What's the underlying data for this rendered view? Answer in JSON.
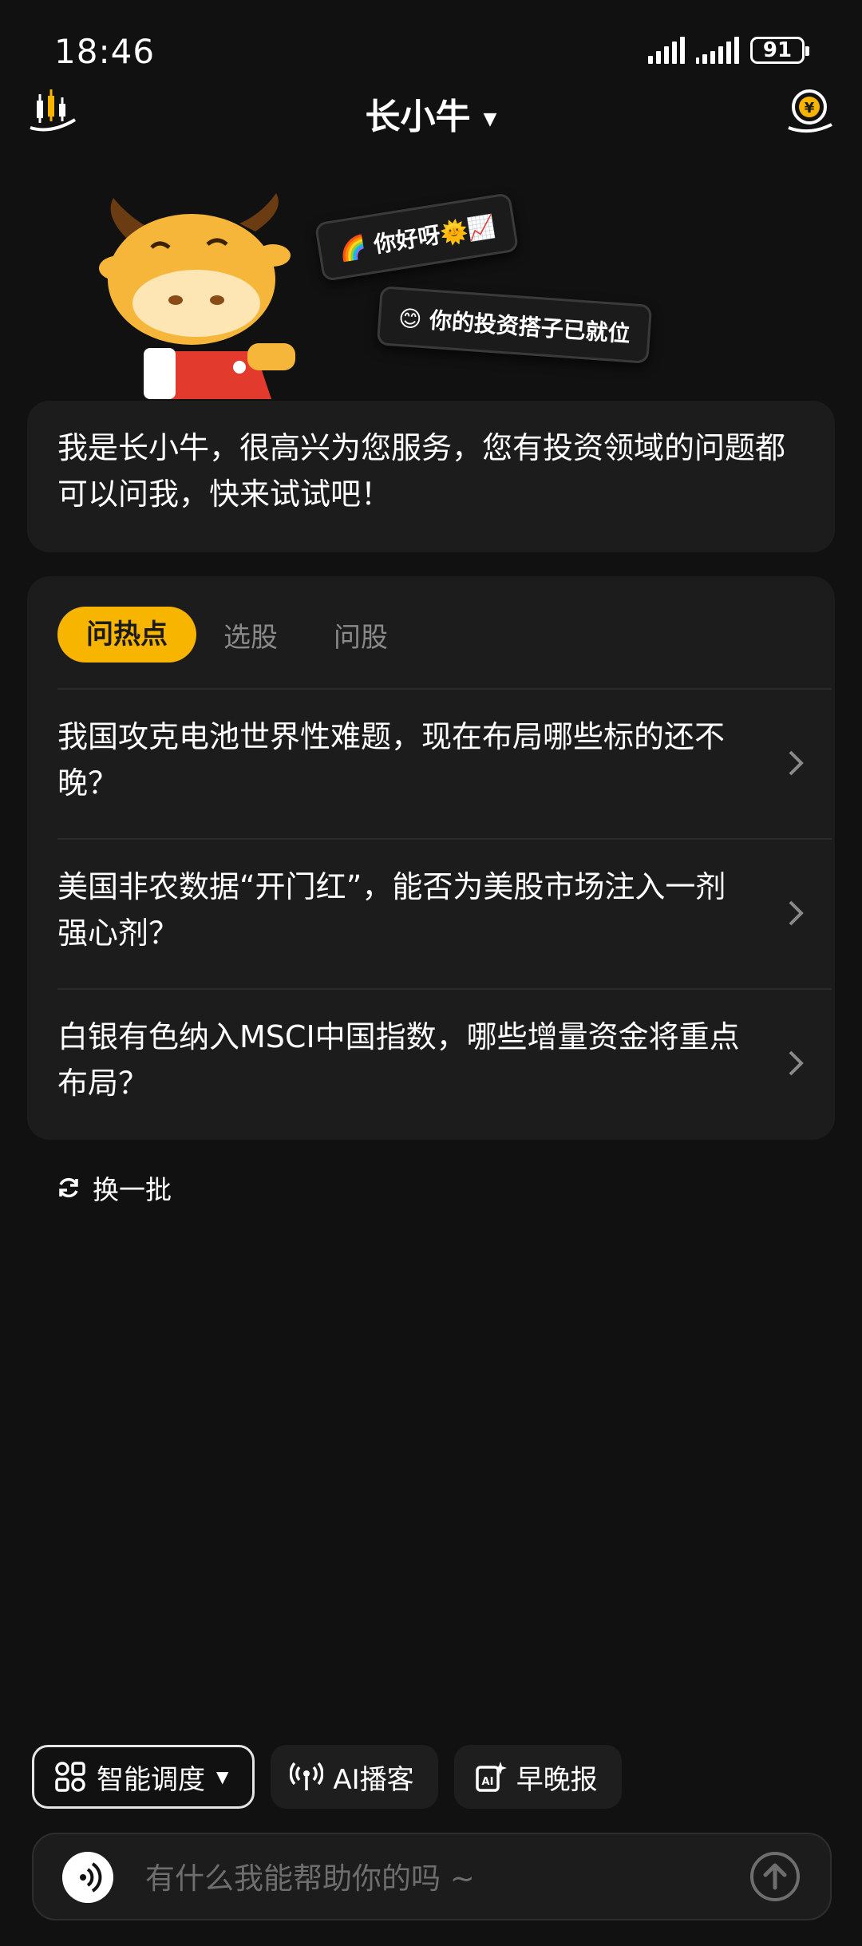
{
  "status_bar": {
    "time": "18:46",
    "battery": "91"
  },
  "nav": {
    "title": "长小牛",
    "left_icon": "candlestick-chart-icon",
    "right_icon": "yuan-coin-icon"
  },
  "hero": {
    "bubble1": "🌈 你好呀🌞📈",
    "bubble2": "😊 你的投资搭子已就位"
  },
  "intro": {
    "text": "我是长小牛，很高兴为您服务，您有投资领域的问题都可以问我，快来试试吧！"
  },
  "tabs": [
    {
      "label": "问热点",
      "active": true
    },
    {
      "label": "选股",
      "active": false
    },
    {
      "label": "问股",
      "active": false
    }
  ],
  "questions": [
    {
      "text": "我国攻克电池世界性难题，现在布局哪些标的还不晚？"
    },
    {
      "text": "美国非农数据“开门红”，能否为美股市场注入一剂强心剂？"
    },
    {
      "text": "白银有色纳入MSCI中国指数，哪些增量资金将重点布局？"
    }
  ],
  "refresh_label": "换一批",
  "chips": {
    "dispatch": "智能调度",
    "podcast": "AI播客",
    "report": "早晚报"
  },
  "input": {
    "placeholder": "有什么我能帮助你的吗 ~"
  },
  "colors": {
    "background": "#111111",
    "card": "#1c1c1c",
    "accent": "#f7b500"
  }
}
